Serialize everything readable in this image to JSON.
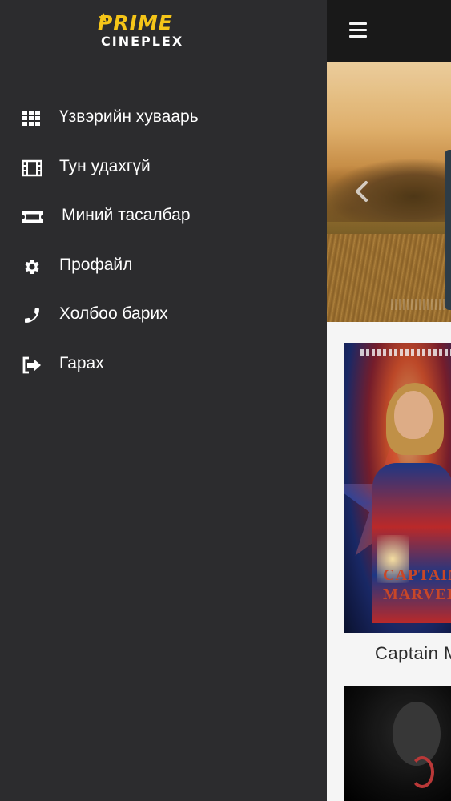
{
  "app": {
    "logo_primary": "PRIME",
    "logo_secondary": "CINEPLEX",
    "brand_color": "#f5c518",
    "drawer_background": "#2c2c2e",
    "topbar_background": "#1b1b1b"
  },
  "header": {
    "menu_icon": "hamburger-icon"
  },
  "drawer": {
    "items": [
      {
        "label": "Үзвэрийн хуваарь",
        "icon": "grid-icon"
      },
      {
        "label": "Тун удахгүй",
        "icon": "film-icon"
      },
      {
        "label": "Миний тасалбар",
        "icon": "ticket-icon"
      },
      {
        "label": "Профайл",
        "icon": "gear-icon"
      },
      {
        "label": "Холбоо барих",
        "icon": "phone-icon"
      },
      {
        "label": "Гарах",
        "icon": "logout-icon"
      }
    ]
  },
  "main": {
    "banner_prev_icon": "chevron-left-icon",
    "movies": [
      {
        "title": "Captain M",
        "poster_text": "CAPTAIN MARVEL"
      }
    ]
  }
}
